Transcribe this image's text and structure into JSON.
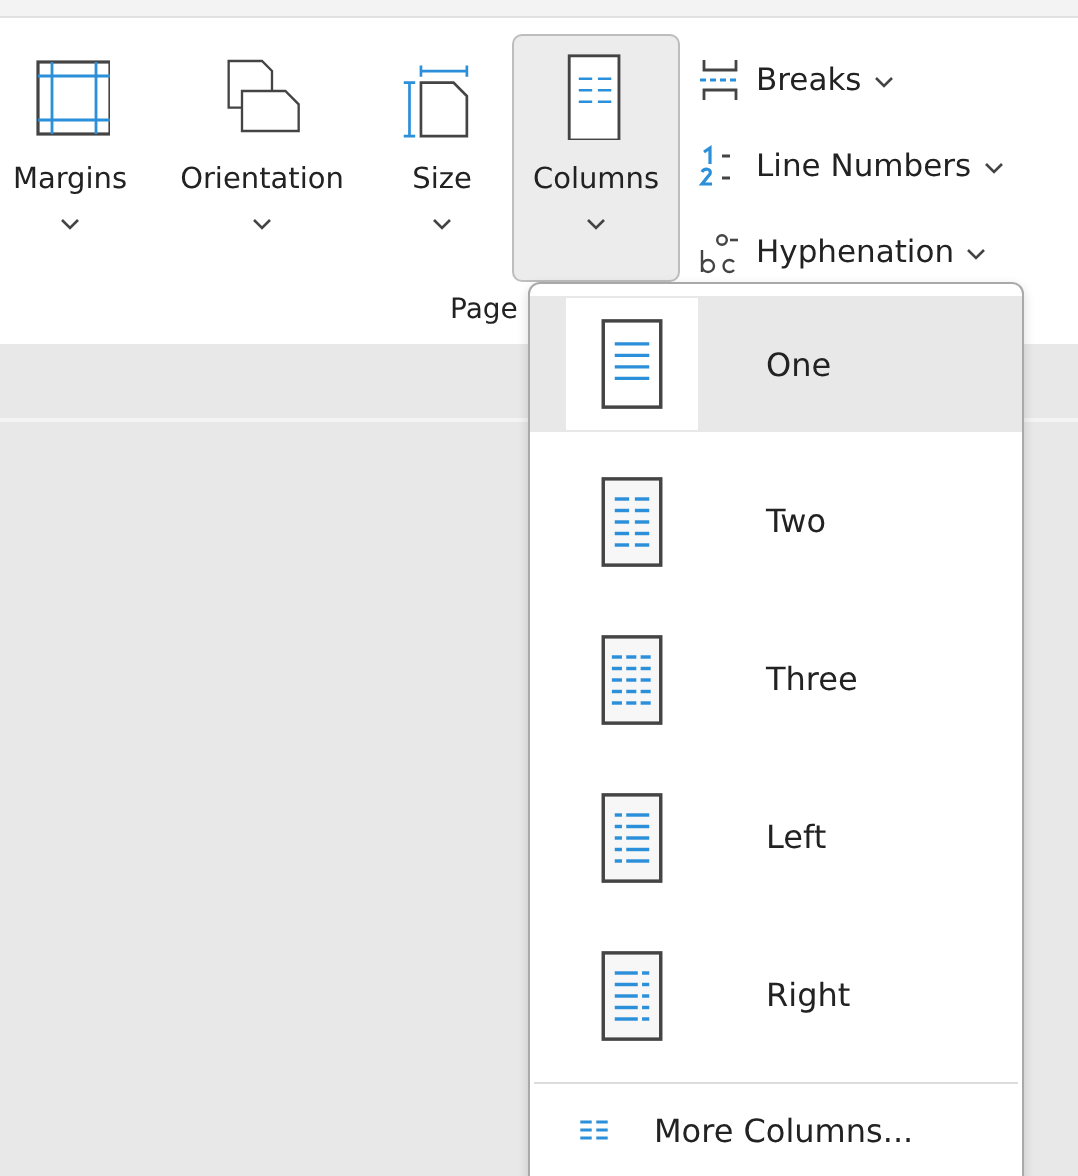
{
  "ribbon": {
    "buttons": [
      {
        "kind": "margins",
        "label": "Margins",
        "pressed": false
      },
      {
        "kind": "orientation",
        "label": "Orientation",
        "pressed": false
      },
      {
        "kind": "size",
        "label": "Size",
        "pressed": false
      },
      {
        "kind": "columns",
        "label": "Columns",
        "pressed": true
      }
    ],
    "small_buttons": [
      {
        "kind": "breaks",
        "label": "Breaks"
      },
      {
        "kind": "line_numbers",
        "label": "Line Numbers"
      },
      {
        "kind": "hyphenation",
        "label": "Hyphenation"
      }
    ],
    "group_label": "Page"
  },
  "columns_menu": {
    "items": [
      {
        "kind": "one",
        "label": "One",
        "selected": true
      },
      {
        "kind": "two",
        "label": "Two",
        "selected": false
      },
      {
        "kind": "three",
        "label": "Three",
        "selected": false
      },
      {
        "kind": "left",
        "label": "Left",
        "selected": false
      },
      {
        "kind": "right",
        "label": "Right",
        "selected": false
      }
    ],
    "more": "More Columns..."
  }
}
